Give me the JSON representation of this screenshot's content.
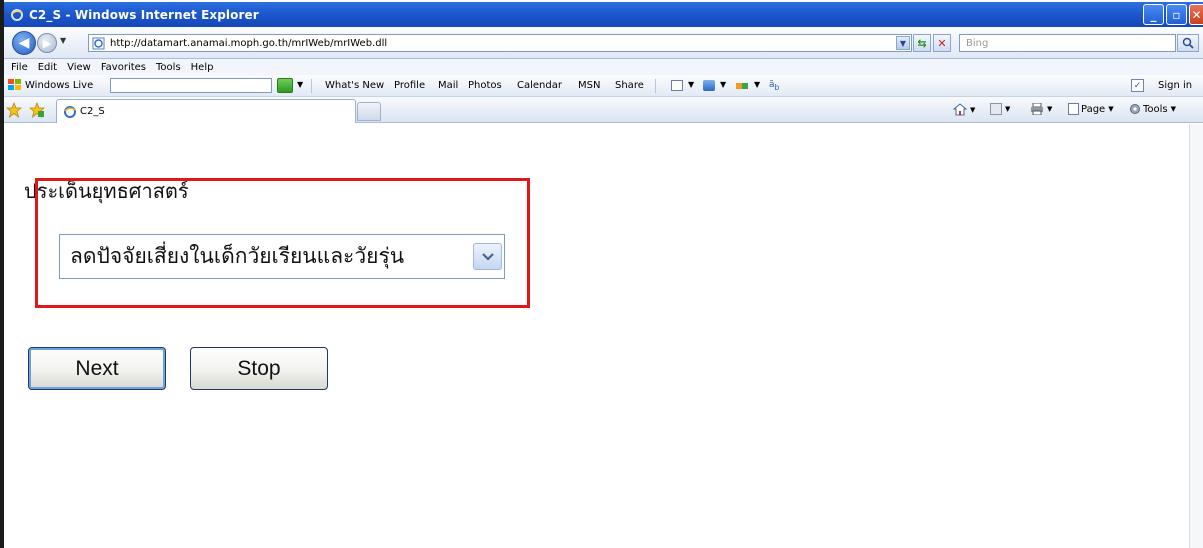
{
  "window": {
    "title": "C2_S - Windows Internet Explorer",
    "controls": {
      "minimize": "_",
      "maximize": "▫",
      "close": "✕"
    }
  },
  "address_bar": {
    "url": "http://datamart.anamai.moph.go.th/mrIWeb/mrIWeb.dll",
    "search_placeholder": "Bing"
  },
  "menu": [
    "File",
    "Edit",
    "View",
    "Favorites",
    "Tools",
    "Help"
  ],
  "live_toolbar": {
    "brand": "Windows Live",
    "links": [
      "What's New",
      "Profile",
      "Mail",
      "Photos",
      "Calendar",
      "MSN",
      "Share"
    ],
    "signin": "Sign in"
  },
  "tabs": {
    "active_tab": "C2_S"
  },
  "command_bar": {
    "page": "Page",
    "tools": "Tools"
  },
  "content": {
    "heading": "ประเด็นยุทธศาสตร์",
    "select_value": "ลดปัจจัยเสี่ยงในเด็กวัยเรียนและวัยรุ่น",
    "next_button": "Next",
    "stop_button": "Stop"
  },
  "colors": {
    "highlight_border": "#e0181a",
    "titlebar": "#1d58cf"
  }
}
